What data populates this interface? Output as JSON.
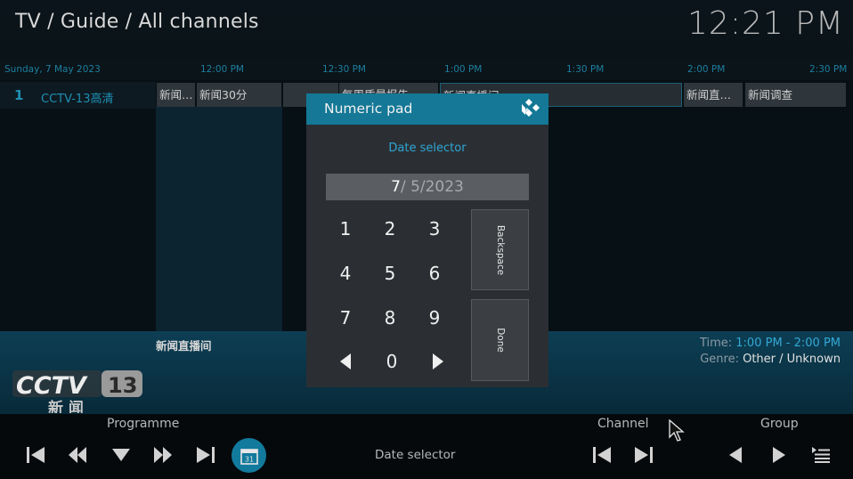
{
  "header": {
    "breadcrumb": "TV / Guide / All channels",
    "clock": "12:21 PM"
  },
  "timeline": {
    "date": "Sunday, 7 May 2023",
    "slots": [
      "12:00 PM",
      "12:30 PM",
      "1:00 PM",
      "1:30 PM",
      "2:00 PM",
      "2:30 PM"
    ]
  },
  "channels": [
    {
      "number": "1",
      "name": "CCTV-13高清",
      "programmes": [
        {
          "title": "新闻…"
        },
        {
          "title": "新闻30分"
        },
        {
          "title": ""
        },
        {
          "title": "每周质量报告"
        },
        {
          "title": "新闻直播间"
        },
        {
          "title": "新闻直…"
        },
        {
          "title": "新闻调查"
        }
      ]
    }
  ],
  "info": {
    "title": "新闻直播间",
    "time_label": "Time: ",
    "time_value": "1:00 PM - 2:00 PM",
    "genre_label": "Genre: ",
    "genre_value": "Other / Unknown"
  },
  "logo": {
    "brand": "CCTV",
    "number": "13",
    "sub": "新 闻"
  },
  "dialog": {
    "title": "Numeric pad",
    "subtitle": "Date selector",
    "value_current": "7",
    "value_rest": "/ 5/2023",
    "keys": [
      "1",
      "2",
      "3",
      "4",
      "5",
      "6",
      "7",
      "8",
      "9",
      "0"
    ],
    "backspace_label": "Backspace",
    "done_label": "Done",
    "icons": {
      "left": "arrow-left-icon",
      "right": "arrow-right-icon",
      "logo": "kodi-logo-icon"
    }
  },
  "bottombar": {
    "programme_label": "Programme",
    "channel_label": "Channel",
    "group_label": "Group",
    "date_selector_label": "Date selector",
    "icons": [
      "skip-back-icon",
      "rewind-icon",
      "down-arrow-icon",
      "fast-forward-icon",
      "skip-forward-icon",
      "calendar-icon",
      "channel-prev-icon",
      "channel-next-icon",
      "group-prev-icon",
      "group-next-icon",
      "playlist-icon"
    ],
    "calendar_day": "31"
  },
  "colors": {
    "accent": "#147896",
    "accent_text": "#2ea6d6",
    "background": "#05090c"
  }
}
